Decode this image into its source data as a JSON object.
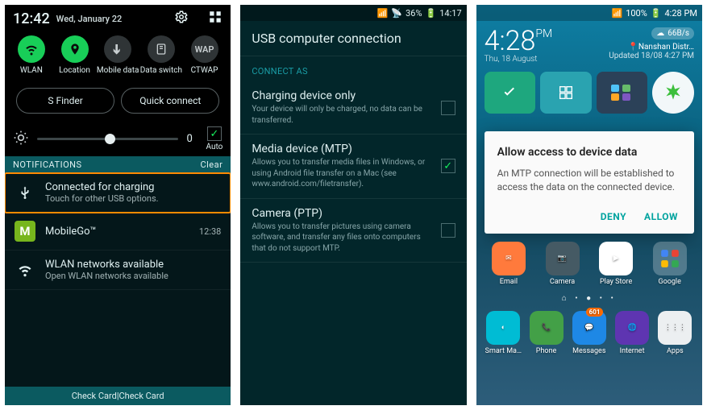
{
  "screen1": {
    "clock": "12:42",
    "date": "Wed, January 22",
    "toggles": [
      {
        "label": "WLAN",
        "icon": "wifi-icon",
        "on": true
      },
      {
        "label": "Location",
        "icon": "location-icon",
        "on": true
      },
      {
        "label": "Mobile data",
        "icon": "arrows-icon",
        "on": false
      },
      {
        "label": "Data switch",
        "icon": "data-switch-icon",
        "on": false
      },
      {
        "label": "CTWAP",
        "icon": "wap-icon",
        "text": "WAP",
        "on": false
      }
    ],
    "sfinder_label": "S Finder",
    "quickconnect_label": "Quick connect",
    "brightness_value": "0",
    "auto_label": "Auto",
    "notifications_header": "NOTIFICATIONS",
    "clear_label": "Clear",
    "notifications": [
      {
        "title": "Connected for charging",
        "sub": "Touch for other USB options.",
        "highlight": true
      },
      {
        "title": "MobileGo™",
        "sub": "",
        "time": "12:38"
      },
      {
        "title": "WLAN networks available",
        "sub": "Open WLAN networks available"
      }
    ],
    "footer": "Check Card|Check Card"
  },
  "screen2": {
    "status": {
      "battery": "36%",
      "time": "14:17"
    },
    "title": "USB computer connection",
    "section": "CONNECT AS",
    "options": [
      {
        "title": "Charging device only",
        "desc": "Your device will only be charged, no data can be transferred.",
        "checked": false
      },
      {
        "title": "Media device (MTP)",
        "desc": "Allows you to transfer media files in Windows, or using Android file transfer on a Mac (see www.android.com/filetransfer).",
        "checked": true
      },
      {
        "title": "Camera (PTP)",
        "desc": "Allows you to transfer pictures using camera software, and transfer any files onto computers that do not support MTP.",
        "checked": false
      }
    ]
  },
  "screen3": {
    "status": {
      "battery": "100%",
      "time": "4:28 PM"
    },
    "transfer_rate": "66B/s",
    "clock": "4:28",
    "ampm": "PM",
    "date": "Thu, 18 August",
    "location": "Nanshan Distr…",
    "updated": "Updated 18/08 4:27 PM",
    "dialog": {
      "title": "Allow access to device data",
      "body": "An MTP connection will be established to access the data on the connected device.",
      "deny": "DENY",
      "allow": "ALLOW"
    },
    "row1": [
      {
        "label": "Email"
      },
      {
        "label": "Camera"
      },
      {
        "label": "Play Store"
      },
      {
        "label": "Google"
      }
    ],
    "dock": [
      {
        "label": "Smart Ma…"
      },
      {
        "label": "Phone"
      },
      {
        "label": "Messages",
        "badge": "601"
      },
      {
        "label": "Internet"
      },
      {
        "label": "Apps"
      }
    ]
  }
}
